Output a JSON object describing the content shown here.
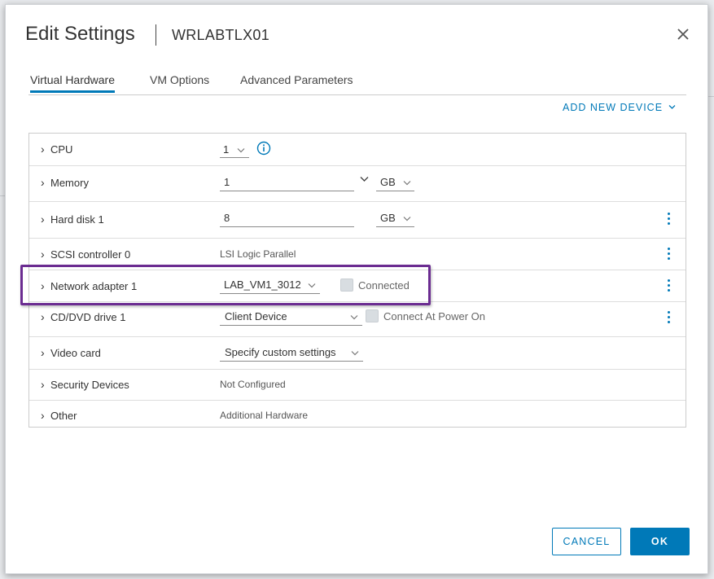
{
  "dialog": {
    "title": "Edit Settings",
    "vm_name": "WRLABTLX01"
  },
  "tabs": [
    {
      "label": "Virtual Hardware",
      "active": true
    },
    {
      "label": "VM Options",
      "active": false
    },
    {
      "label": "Advanced Parameters",
      "active": false
    }
  ],
  "add_new_device": "ADD NEW DEVICE",
  "hardware": {
    "cpu": {
      "label": "CPU",
      "value": "1"
    },
    "memory": {
      "label": "Memory",
      "value": "1",
      "unit": "GB"
    },
    "hard_disk": {
      "label": "Hard disk 1",
      "value": "8",
      "unit": "GB"
    },
    "scsi": {
      "label": "SCSI controller 0",
      "value": "LSI Logic Parallel"
    },
    "network": {
      "label": "Network adapter 1",
      "value": "LAB_VM1_3012",
      "checkbox_label": "Connected"
    },
    "cddvd": {
      "label": "CD/DVD drive 1",
      "value": "Client Device",
      "checkbox_label": "Connect At Power On"
    },
    "video": {
      "label": "Video card",
      "value": "Specify custom settings"
    },
    "security": {
      "label": "Security Devices",
      "value": "Not Configured"
    },
    "other": {
      "label": "Other",
      "value": "Additional Hardware"
    }
  },
  "buttons": {
    "cancel": "CANCEL",
    "ok": "OK"
  },
  "colors": {
    "accent": "#0079b8",
    "highlight": "#6b2c91"
  }
}
